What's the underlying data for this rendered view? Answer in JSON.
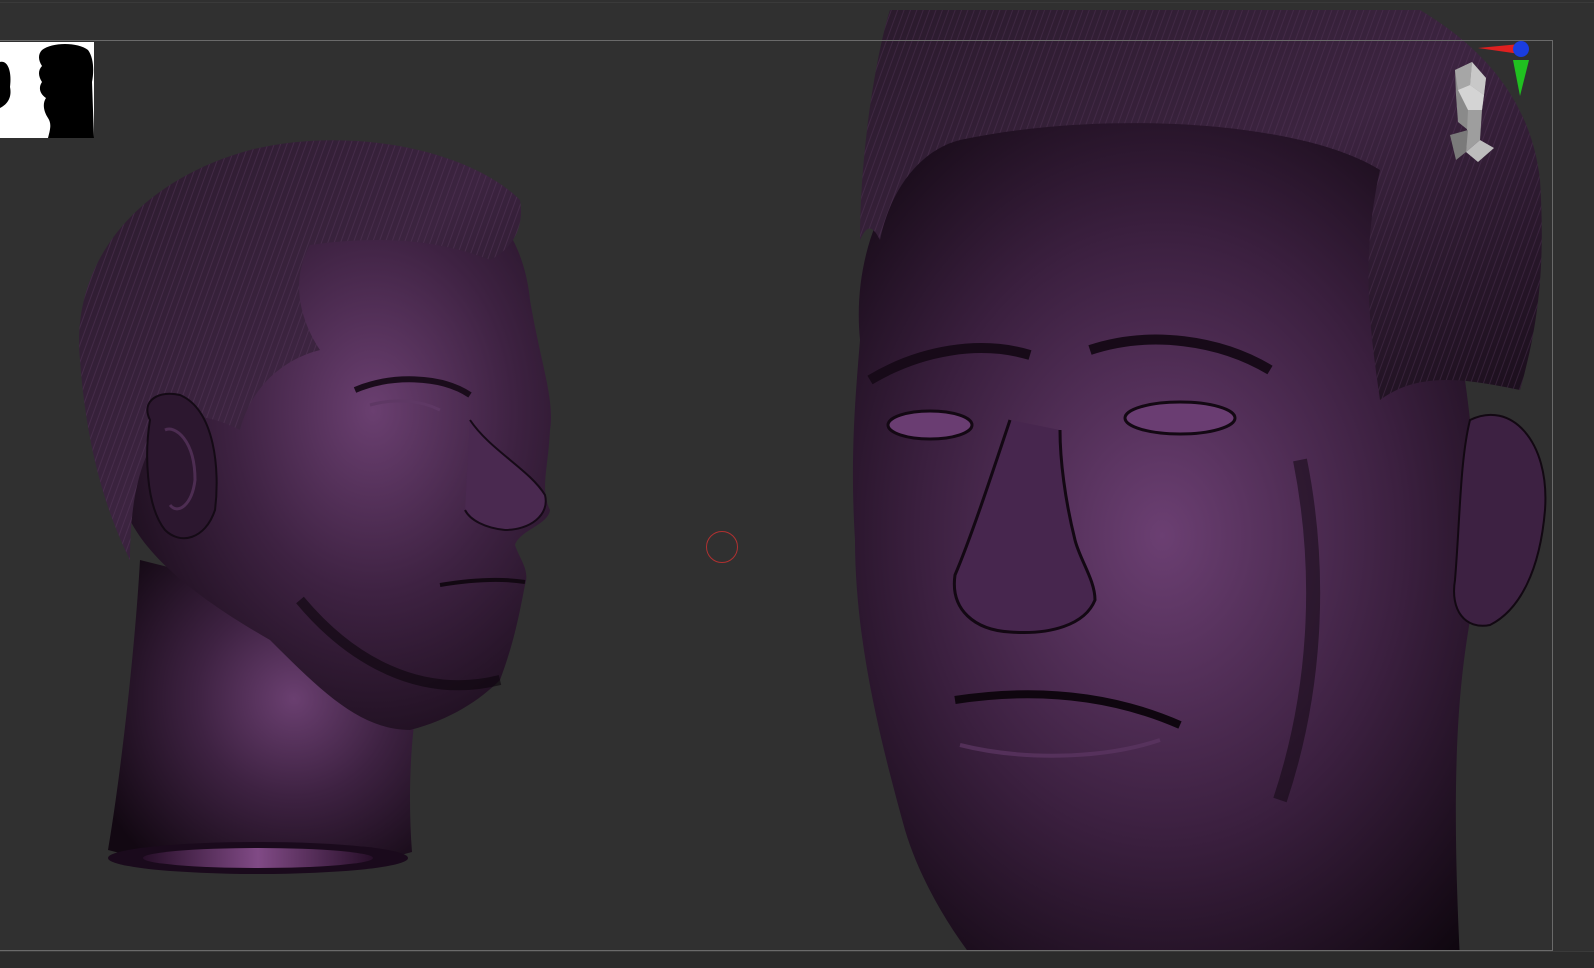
{
  "app": {
    "window_title": ""
  },
  "viewport": {
    "background_color": "#303030",
    "frame_color": "#6a6a6a",
    "material_color": "#4a2a4e",
    "material_highlight": "#7a4d80"
  },
  "thumbnail": {
    "icon": "head-silhouette-icon"
  },
  "navigation": {
    "icon": "navigation-head-gizmo-icon",
    "axis_colors": {
      "x": "#e02020",
      "y": "#20c020",
      "z": "#1a3de0"
    }
  },
  "cursor": {
    "icon": "brush-cursor-icon",
    "color": "#b03030"
  }
}
